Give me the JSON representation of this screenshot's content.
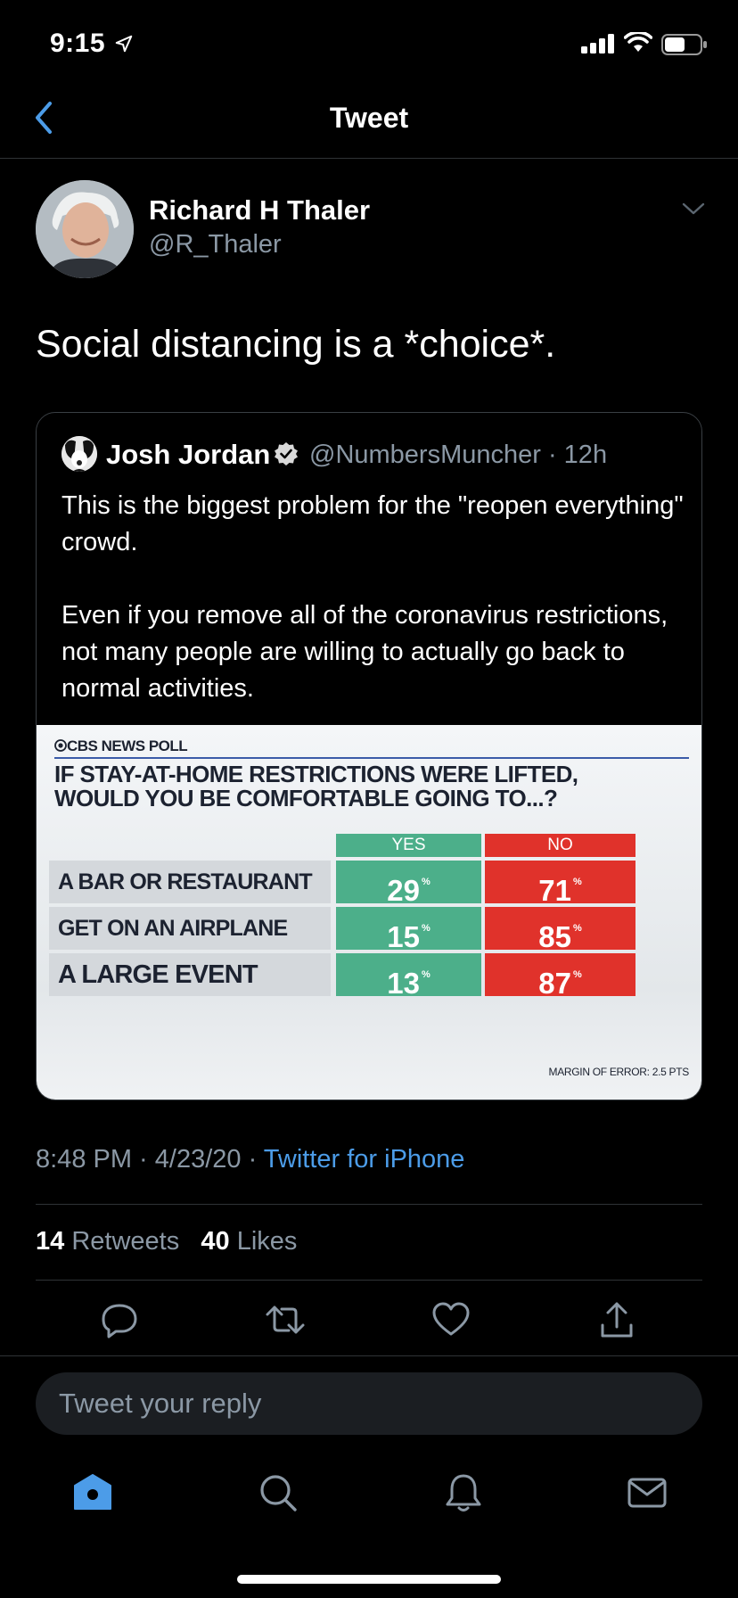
{
  "status_bar": {
    "time": "9:15"
  },
  "nav": {
    "title": "Tweet"
  },
  "tweet": {
    "author_name": "Richard H Thaler",
    "author_handle": "@R_Thaler",
    "text": "Social distancing is a *choice*.",
    "timestamp": "8:48 PM · 4/23/20 · ",
    "source": "Twitter for iPhone",
    "retweets_count": "14",
    "retweets_label": "Retweets",
    "likes_count": "40",
    "likes_label": "Likes"
  },
  "quote": {
    "author_name": "Josh Jordan",
    "author_handle": "@NumbersMuncher · 12h",
    "paragraphs": [
      "This is the biggest problem for the \"reopen everything\" crowd.",
      "Even if you remove all of the coronavirus restrictions, not many people are willing to actually go back to normal activities."
    ]
  },
  "poll": {
    "brand": "CBS NEWS POLL",
    "headline_line1": "IF STAY-AT-HOME RESTRICTIONS WERE LIFTED,",
    "headline_line2": "WOULD YOU BE COMFORTABLE GOING TO...?",
    "yes_label": "YES",
    "no_label": "NO",
    "percent_mark": "%",
    "rows": [
      {
        "label": "A BAR OR RESTAURANT",
        "yes": "29",
        "no": "71"
      },
      {
        "label": "GET ON AN AIRPLANE",
        "yes": "15",
        "no": "85"
      },
      {
        "label": "A LARGE EVENT",
        "yes": "13",
        "no": "87"
      }
    ],
    "margin_of_error": "MARGIN OF ERROR: 2.5 PTS",
    "colors": {
      "yes": "#4caf8a",
      "no": "#e0322b"
    }
  },
  "reply": {
    "placeholder": "Tweet your reply"
  },
  "icons": {
    "status": [
      "location-arrow-icon",
      "cellular-signal-icon",
      "wifi-icon",
      "battery-icon"
    ],
    "actions": [
      "reply-icon",
      "retweet-icon",
      "like-icon",
      "share-icon"
    ],
    "tabs": [
      "home-icon",
      "search-icon",
      "notifications-icon",
      "messages-icon"
    ]
  },
  "colors": {
    "accent": "#4c9ce8",
    "background": "#000000",
    "secondary_text": "#8b98a5"
  }
}
